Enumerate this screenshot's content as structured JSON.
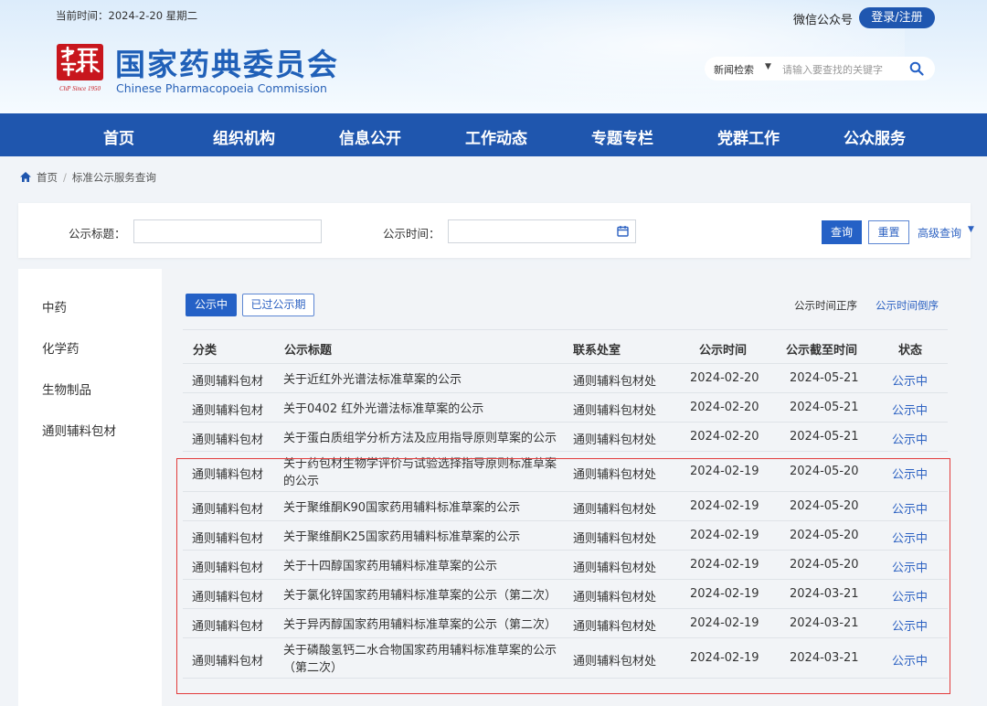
{
  "header": {
    "date_text": "当前时间：2024-2-20 星期二",
    "wechat": "微信公众号",
    "login": "登录/注册",
    "title": "国家药典委员会",
    "subtitle": "Chinese Pharmacopoeia Commission",
    "seal_text": "ChP Since 1950",
    "search_category": "新闻检索",
    "search_placeholder": "请输入要查找的关键字"
  },
  "nav": [
    "首页",
    "组织机构",
    "信息公开",
    "工作动态",
    "专题专栏",
    "党群工作",
    "公众服务"
  ],
  "breadcrumb": [
    "首页",
    "标准公示服务查询"
  ],
  "filter": {
    "title_label": "公示标题：",
    "time_label": "公示时间：",
    "query": "查询",
    "reset": "重置",
    "advanced": "高级查询"
  },
  "sidebar": [
    "中药",
    "化学药",
    "生物制品",
    "通则辅料包材"
  ],
  "tabs": {
    "active": "公示中",
    "inactive": "已过公示期"
  },
  "sort": {
    "asc": "公示时间正序",
    "desc": "公示时间倒序"
  },
  "table": {
    "headers": [
      "分类",
      "公示标题",
      "联系处室",
      "公示时间",
      "公示截至时间",
      "状态"
    ],
    "rows": [
      [
        "通则辅料包材",
        "关于近红外光谱法标准草案的公示",
        "通则辅料包材处",
        "2024-02-20",
        "2024-05-21",
        "公示中"
      ],
      [
        "通则辅料包材",
        "关于0402 红外光谱法标准草案的公示",
        "通则辅料包材处",
        "2024-02-20",
        "2024-05-21",
        "公示中"
      ],
      [
        "通则辅料包材",
        "关于蛋白质组学分析方法及应用指导原则草案的公示",
        "通则辅料包材处",
        "2024-02-20",
        "2024-05-21",
        "公示中"
      ],
      [
        "通则辅料包材",
        "关于药包材生物学评价与试验选择指导原则标准草案的公示",
        "通则辅料包材处",
        "2024-02-19",
        "2024-05-20",
        "公示中"
      ],
      [
        "通则辅料包材",
        "关于聚维酮K90国家药用辅料标准草案的公示",
        "通则辅料包材处",
        "2024-02-19",
        "2024-05-20",
        "公示中"
      ],
      [
        "通则辅料包材",
        "关于聚维酮K25国家药用辅料标准草案的公示",
        "通则辅料包材处",
        "2024-02-19",
        "2024-05-20",
        "公示中"
      ],
      [
        "通则辅料包材",
        "关于十四醇国家药用辅料标准草案的公示",
        "通则辅料包材处",
        "2024-02-19",
        "2024-05-20",
        "公示中"
      ],
      [
        "通则辅料包材",
        "关于氯化锌国家药用辅料标准草案的公示（第二次）",
        "通则辅料包材处",
        "2024-02-19",
        "2024-03-21",
        "公示中"
      ],
      [
        "通则辅料包材",
        "关于异丙醇国家药用辅料标准草案的公示（第二次）",
        "通则辅料包材处",
        "2024-02-19",
        "2024-03-21",
        "公示中"
      ],
      [
        "通则辅料包材",
        "关于磷酸氢钙二水合物国家药用辅料标准草案的公示（第二次）",
        "通则辅料包材处",
        "2024-02-19",
        "2024-03-21",
        "公示中"
      ]
    ]
  },
  "colors": {
    "brand_blue": "#1f56ae",
    "link_blue": "#2d62c2",
    "seal_red": "#c8161d",
    "highlight_red": "#e23b3b"
  }
}
